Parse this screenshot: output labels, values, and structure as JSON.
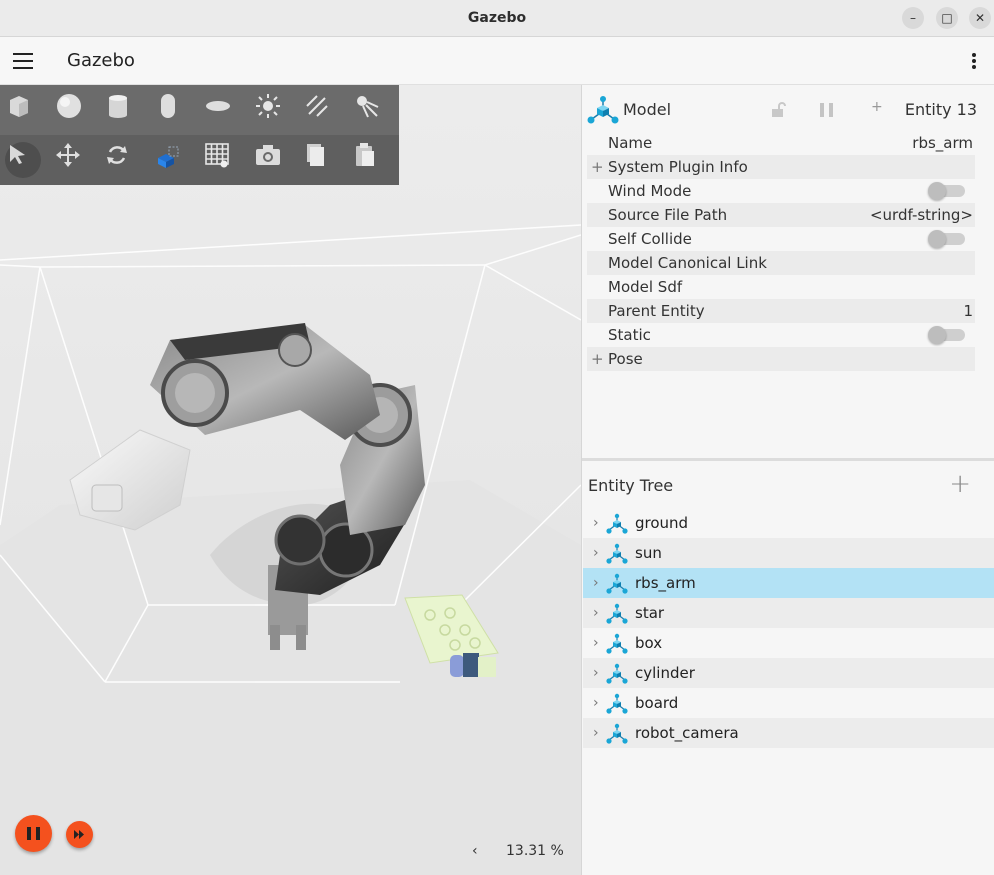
{
  "window": {
    "title": "Gazebo"
  },
  "appbar": {
    "title": "Gazebo"
  },
  "component_inspector": {
    "type_label": "Model",
    "entity_label": "Entity 13",
    "rows": [
      {
        "label": "Name",
        "value": "rbs_arm",
        "kind": "text"
      },
      {
        "label": "System Plugin Info",
        "value": "",
        "kind": "expand"
      },
      {
        "label": "Wind Mode",
        "value": "",
        "kind": "toggle"
      },
      {
        "label": "Source File Path",
        "value": "<urdf-string>",
        "kind": "text"
      },
      {
        "label": "Self Collide",
        "value": "",
        "kind": "toggle"
      },
      {
        "label": "Model Canonical Link",
        "value": "",
        "kind": "text"
      },
      {
        "label": "Model Sdf",
        "value": "",
        "kind": "text"
      },
      {
        "label": "Parent Entity",
        "value": "1",
        "kind": "text"
      },
      {
        "label": "Static",
        "value": "",
        "kind": "toggle"
      },
      {
        "label": "Pose",
        "value": "",
        "kind": "expand"
      }
    ]
  },
  "entity_tree": {
    "title": "Entity Tree",
    "items": [
      {
        "label": "ground",
        "selected": false
      },
      {
        "label": "sun",
        "selected": false
      },
      {
        "label": "rbs_arm",
        "selected": true
      },
      {
        "label": "star",
        "selected": false
      },
      {
        "label": "box",
        "selected": false
      },
      {
        "label": "cylinder",
        "selected": false
      },
      {
        "label": "board",
        "selected": false
      },
      {
        "label": "robot_camera",
        "selected": false
      }
    ]
  },
  "shapes_toolbar": [
    "box-icon",
    "sphere-icon",
    "cylinder-icon",
    "capsule-icon",
    "ellipsoid-icon",
    "sun-light-icon",
    "directional-light-icon",
    "spot-light-icon"
  ],
  "tools_toolbar": [
    "select-arrow-icon",
    "translate-icon",
    "rotate-icon",
    "align-icon",
    "grid-icon",
    "camera-icon",
    "copy-icon",
    "paste-icon"
  ],
  "status": {
    "real_time_factor": "13.31 %",
    "prev_arrow": "‹"
  },
  "colors": {
    "accent": "#f4511e",
    "selection": "#b3e2f5",
    "model_icon": "#1aa6d6"
  }
}
